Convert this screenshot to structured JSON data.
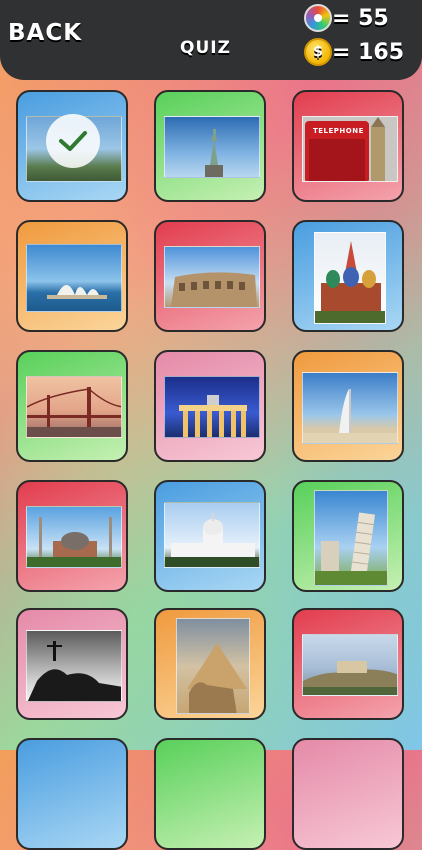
{
  "header": {
    "back_label": "BACK",
    "title": "QUIZ",
    "hints": {
      "icon": "color-wheel-icon",
      "value": "= 55"
    },
    "coins": {
      "icon": "dollar-coin-icon",
      "symbol": "$",
      "value": "= 165"
    }
  },
  "colors": {
    "header_bg": "#2f3133",
    "tile_blue": "#5aa9e6",
    "tile_green": "#6fd66f",
    "tile_red": "#e2475a",
    "tile_orange": "#f0a24a",
    "tile_pink": "#e58aa8"
  },
  "tiles": [
    {
      "id": "paris",
      "completed": true,
      "tile_color": "blue",
      "check_icon": "checkmark-icon"
    },
    {
      "id": "statue-of-liberty",
      "completed": false,
      "tile_color": "green"
    },
    {
      "id": "london-telephone-booth",
      "completed": false,
      "tile_color": "red",
      "photo_text": "TELEPHONE"
    },
    {
      "id": "sydney-opera-house",
      "completed": false,
      "tile_color": "orange"
    },
    {
      "id": "colosseum",
      "completed": false,
      "tile_color": "red"
    },
    {
      "id": "st-basils-cathedral",
      "completed": false,
      "tile_color": "blue"
    },
    {
      "id": "golden-gate-bridge",
      "completed": false,
      "tile_color": "green"
    },
    {
      "id": "brandenburg-gate",
      "completed": false,
      "tile_color": "pink"
    },
    {
      "id": "burj-al-arab",
      "completed": false,
      "tile_color": "orange"
    },
    {
      "id": "hagia-sophia",
      "completed": false,
      "tile_color": "red"
    },
    {
      "id": "us-capitol",
      "completed": false,
      "tile_color": "blue"
    },
    {
      "id": "leaning-tower-of-pisa",
      "completed": false,
      "tile_color": "green"
    },
    {
      "id": "christ-the-redeemer",
      "completed": false,
      "tile_color": "pink"
    },
    {
      "id": "pyramids-and-sphinx",
      "completed": false,
      "tile_color": "orange"
    },
    {
      "id": "acropolis",
      "completed": false,
      "tile_color": "red"
    }
  ]
}
